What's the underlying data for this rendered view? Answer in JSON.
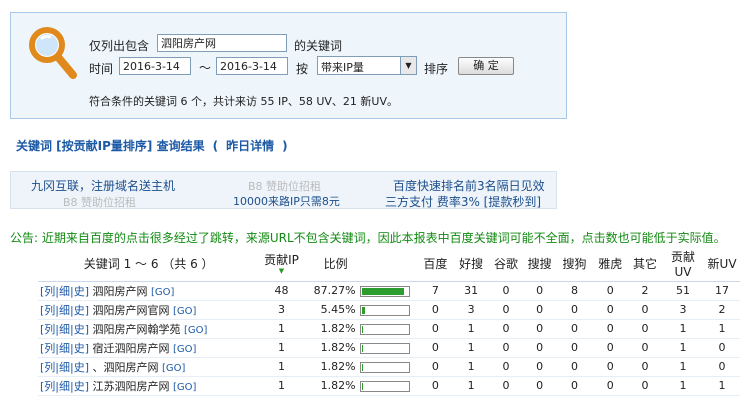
{
  "filter": {
    "only_label": "仅列出包含",
    "keyword_value": "泗阳房产网",
    "keyword_suffix": "的关键词",
    "time_label": "时间",
    "date_from": "2016-3-14",
    "date_sep": "～",
    "date_to": "2016-3-14",
    "by_label": "按",
    "sort_select": "带来IP量",
    "sort_label": "排序",
    "confirm_label": "确 定",
    "summary": "符合条件的关键词 6 个，共计来访 55 IP、58 UV、21 新UV。"
  },
  "heading": {
    "title": "关键词 [按贡献IP量排序] 查询结果",
    "open_paren": "(",
    "yesterday": "昨日详情",
    "close_paren": ")"
  },
  "ads": {
    "ad1": "九冈互联，注册域名送主机",
    "ad2": "B8 赞助位招租",
    "ad3": "B8 赞助位招租",
    "ad4": "百度快速排名前3名隔日见效",
    "ad5": "B8 赞助位招租",
    "ad6": "10000来路IP只需8元",
    "ad7": "三方支付 费率3% [提款秒到]"
  },
  "notice": "公告: 近期来自百度的点击很多经过了跳转，来源URL不包含关键词，因此本报表中百度关键词可能不全面，点击数也可能低于实际值。",
  "table": {
    "headers": {
      "keyword": "关键词 1 ～ 6 （共 6 ）",
      "ip": "贡献IP",
      "ratio": "比例",
      "baidu": "百度",
      "haosou": "好搜",
      "google": "谷歌",
      "soso": "搜搜",
      "sogou": "搜狗",
      "yahoo": "雅虎",
      "other": "其它",
      "uv": "贡献UV",
      "newuv": "新UV"
    },
    "rows": [
      {
        "links": "[列|细|史]",
        "keyword": "泗阳房产网",
        "go": "[GO]",
        "ip": "48",
        "pct": "87.27%",
        "ratio": 0.8727,
        "baidu": "7",
        "haosou": "31",
        "google": "0",
        "soso": "0",
        "sogou": "8",
        "yahoo": "0",
        "other": "2",
        "uv": "51",
        "newuv": "17"
      },
      {
        "links": "[列|细|史]",
        "keyword": "泗阳房产网官网",
        "go": "[GO]",
        "ip": "3",
        "pct": "5.45%",
        "ratio": 0.0545,
        "baidu": "0",
        "haosou": "3",
        "google": "0",
        "soso": "0",
        "sogou": "0",
        "yahoo": "0",
        "other": "0",
        "uv": "3",
        "newuv": "2"
      },
      {
        "links": "[列|细|史]",
        "keyword": "泗阳房产网翰学苑",
        "go": "[GO]",
        "ip": "1",
        "pct": "1.82%",
        "ratio": 0.0182,
        "baidu": "0",
        "haosou": "1",
        "google": "0",
        "soso": "0",
        "sogou": "0",
        "yahoo": "0",
        "other": "0",
        "uv": "1",
        "newuv": "1"
      },
      {
        "links": "[列|细|史]",
        "keyword": "宿迁泗阳房产网",
        "go": "[GO]",
        "ip": "1",
        "pct": "1.82%",
        "ratio": 0.0182,
        "baidu": "0",
        "haosou": "1",
        "google": "0",
        "soso": "0",
        "sogou": "0",
        "yahoo": "0",
        "other": "0",
        "uv": "1",
        "newuv": "0"
      },
      {
        "links": "[列|细|史]",
        "keyword": "、泗阳房产网",
        "go": "[GO]",
        "ip": "1",
        "pct": "1.82%",
        "ratio": 0.0182,
        "baidu": "0",
        "haosou": "1",
        "google": "0",
        "soso": "0",
        "sogou": "0",
        "yahoo": "0",
        "other": "0",
        "uv": "1",
        "newuv": "0"
      },
      {
        "links": "[列|细|史]",
        "keyword": "江苏泗阳房产网",
        "go": "[GO]",
        "ip": "1",
        "pct": "1.82%",
        "ratio": 0.0182,
        "baidu": "0",
        "haosou": "1",
        "google": "0",
        "soso": "0",
        "sogou": "0",
        "yahoo": "0",
        "other": "0",
        "uv": "1",
        "newuv": "1"
      }
    ]
  },
  "colors": {
    "link": "#1d5aa6",
    "notice": "#128a12",
    "bar": "#2d9e2d",
    "panel": "#eef5fb"
  },
  "icons": {
    "search": "magnifier-icon"
  }
}
